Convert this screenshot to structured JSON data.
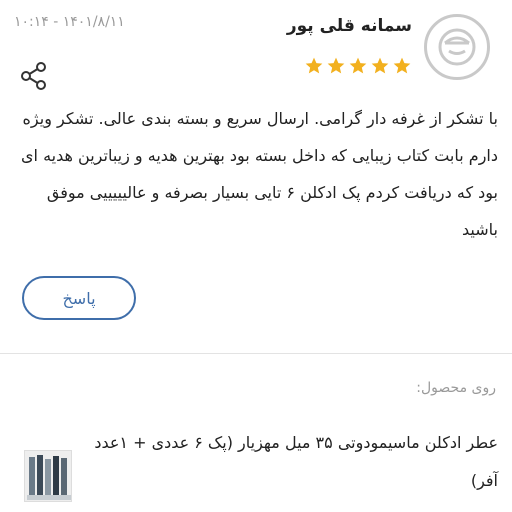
{
  "review": {
    "author": "سمانه قلی پور",
    "date": "۱۴۰۱/۸/۱۱ - ۱۰:۱۴",
    "rating": 5,
    "star_color": "#f2b01e",
    "body": "با تشکر از غرفه دار گرامی. ارسال سریع و بسته بندی عالی. تشکر ویژه دارم بابت کتاب زیبایی که داخل بسته بود بهترین هدیه و زیباترین هدیه ای بود که دریافت کردم پک ادکلن ۶ تایی بسیار بصرفه و عالیییییی موفق باشید",
    "reply_label": "پاسخ",
    "share_icon": "share-icon",
    "avatar_icon": "user-avatar-icon"
  },
  "product": {
    "label": "روی محصول:",
    "title": "عطر ادکلن ماسیمودوتی ۳۵ میل مهزیار (پک ۶ عددی + ۱عدد آفر)"
  },
  "colors": {
    "accent": "#3f6eaa",
    "muted_text": "#9a9a9a"
  }
}
